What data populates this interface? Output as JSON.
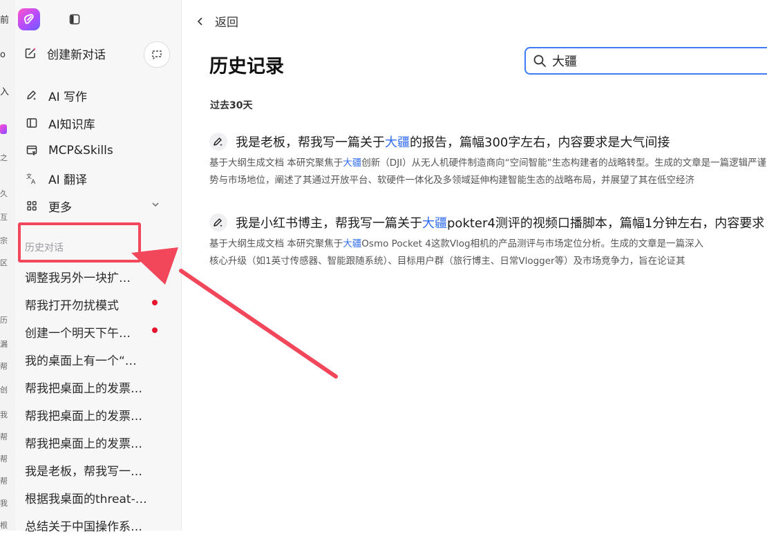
{
  "underlying_window": {
    "glyphs": [
      "前",
      "o",
      "入",
      "之",
      "久",
      "互",
      "宗",
      "区",
      "历",
      "漏",
      "帮",
      "创",
      "我",
      "帮",
      "帮",
      "帮",
      "我",
      "根"
    ]
  },
  "sidebar": {
    "new_chat": "创建新对话",
    "nav": [
      {
        "label": "AI 写作",
        "icon": "pen-sparkle-icon"
      },
      {
        "label": "AI知识库",
        "icon": "book-icon"
      },
      {
        "label": "MCP&Skills",
        "icon": "plug-icon"
      },
      {
        "label": "AI 翻译",
        "icon": "translate-icon"
      },
      {
        "label": "更多",
        "icon": "grid-icon"
      }
    ],
    "history_section": "历史对话",
    "history": [
      {
        "title": "调整我另外一块扩…",
        "unread": false
      },
      {
        "title": "帮我打开勿扰模式",
        "unread": true
      },
      {
        "title": "创建一个明天下午…",
        "unread": true
      },
      {
        "title": "我的桌面上有一个“…",
        "unread": false
      },
      {
        "title": "帮我把桌面上的发票…",
        "unread": false
      },
      {
        "title": "帮我把桌面上的发票…",
        "unread": false
      },
      {
        "title": "帮我把桌面上的发票…",
        "unread": false
      },
      {
        "title": "我是老板，帮我写一…",
        "unread": false
      },
      {
        "title": "根据我桌面的threat-…",
        "unread": false
      },
      {
        "title": "总结关于中国操作系…",
        "unread": false
      }
    ]
  },
  "main": {
    "back_label": "返回",
    "title": "历史记录",
    "search": {
      "value": "大疆",
      "placeholder": ""
    },
    "period": "过去30天",
    "results": [
      {
        "title_before": "我是老板，帮我写一篇关于",
        "title_highlight": "大疆",
        "title_after": "的报告，篇幅300字左右，内容要求是大气间接",
        "line1_before": "基于大纲生成文档 本研究聚焦于",
        "line1_highlight": "大疆",
        "line1_after": "创新（DJI）从无人机硬件制造商向“空间智能”生态构建者的战略转型。生成的文章是一篇逻辑严谨",
        "line2": "势与市场地位，阐述了其通过开放平台、软硬件一体化及多领域延伸构建智能生态的战略布局，并展望了其在低空经济"
      },
      {
        "title_before": "我是小红书博主，帮我写一篇关于",
        "title_highlight": "大疆",
        "title_after": "pokter4测评的视频口播脚本，篇幅1分钟左右，内容要求",
        "line1_before": "基于大纲生成文档 本研究聚焦于",
        "line1_highlight": "大疆",
        "line1_after": "Osmo Pocket 4这款Vlog相机的产品测评与市场定位分析。生成的文章是一篇深入",
        "line2": "核心升级（如1英寸传感器、智能跟随系统）、目标用户群（旅行博主、日常Vlogger等）及市场竞争力，旨在论证其"
      }
    ]
  },
  "colors": {
    "accent": "#3e7bfa",
    "highlight": "#2f6bf0",
    "annotation": "#f2475b",
    "unread_dot": "#e8142b"
  }
}
